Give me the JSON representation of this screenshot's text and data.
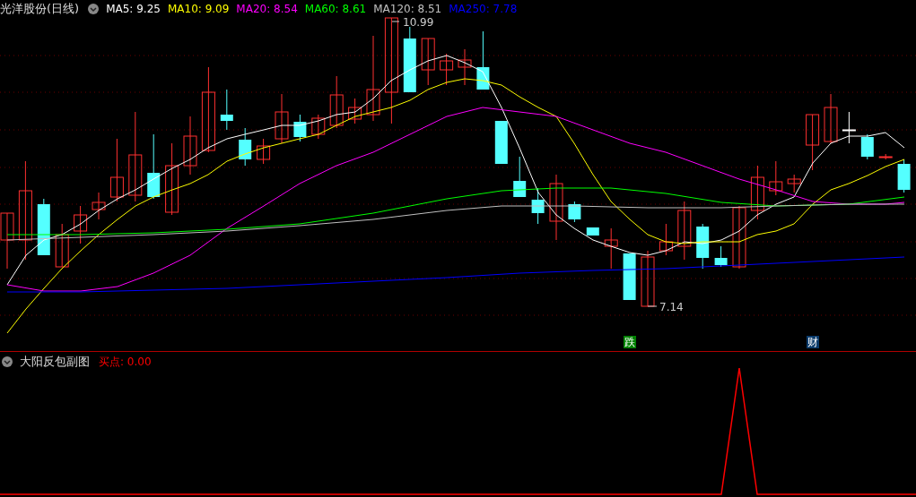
{
  "main_panel": {
    "title": "光洋股份(日线)",
    "indicators": [
      {
        "label": "MA5: 9.25",
        "color": "#ffffff"
      },
      {
        "label": "MA10: 9.09",
        "color": "#ffff00"
      },
      {
        "label": "MA20: 8.54",
        "color": "#ff00ff"
      },
      {
        "label": "MA60: 8.61",
        "color": "#00ff00"
      },
      {
        "label": "MA120: 8.51",
        "color": "#c0c0c0"
      },
      {
        "label": "MA250: 7.78",
        "color": "#0000ff"
      }
    ],
    "high_label": "10.99",
    "low_label": "7.14",
    "markers": [
      {
        "text": "跌",
        "color": "#008000"
      },
      {
        "text": "财",
        "color": "#0a3a6a"
      }
    ]
  },
  "sub_panel": {
    "title": "大阳反包副图",
    "indicators": [
      {
        "label": "买点: 0.00",
        "color": "#ff0000"
      }
    ]
  }
}
